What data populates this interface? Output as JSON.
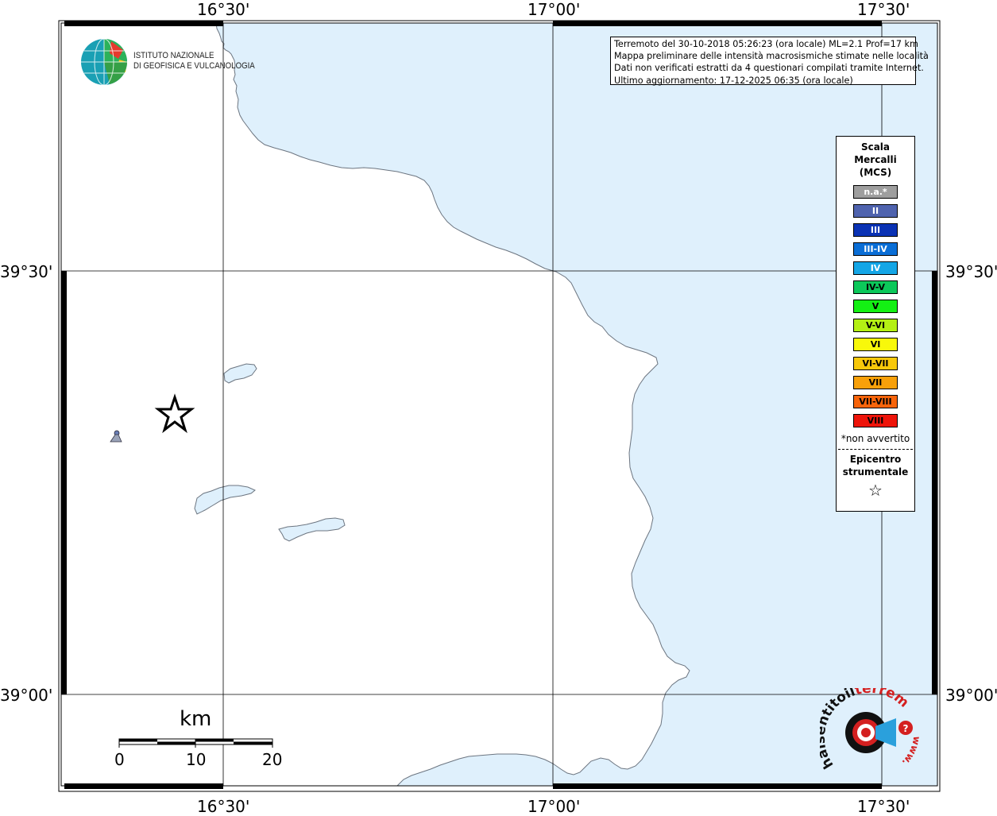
{
  "coords": {
    "top": [
      "16°30'",
      "17°00'",
      "17°30'"
    ],
    "bottom": [
      "16°30'",
      "17°00'",
      "17°30'"
    ],
    "left": [
      "39°30'",
      "39°00'"
    ],
    "right": [
      "39°30'",
      "39°00'"
    ]
  },
  "info": {
    "line1": "Terremoto del 30-10-2018 05:26:23 (ora locale) ML=2.1 Prof=17 km",
    "line2": "Mappa preliminare delle intensità macrosismiche stimate nelle località",
    "line3": "Dati non verificati estratti da 4 questionari compilati tramite Internet.",
    "line4": "Ultimo aggiornamento: 17-12-2025 06:35 (ora locale)"
  },
  "logo": {
    "line1": "ISTITUTO NAZIONALE",
    "line2": "DI GEOFISICA E VULCANOLOGIA"
  },
  "legend": {
    "title1": "Scala",
    "title2": "Mercalli",
    "title3": "(MCS)",
    "items": [
      {
        "label": "n.a.*",
        "color": "#9e9e9e",
        "text": "#ffffff"
      },
      {
        "label": "II",
        "color": "#4f63ae",
        "text": "#ffffff"
      },
      {
        "label": "III",
        "color": "#0a32b4",
        "text": "#ffffff"
      },
      {
        "label": "III-IV",
        "color": "#0a6ed6",
        "text": "#ffffff"
      },
      {
        "label": "IV",
        "color": "#14a6e6",
        "text": "#ffffff"
      },
      {
        "label": "IV-V",
        "color": "#0cc85a",
        "text": "#000000"
      },
      {
        "label": "V",
        "color": "#14f014",
        "text": "#000000"
      },
      {
        "label": "V-VI",
        "color": "#b4f014",
        "text": "#000000"
      },
      {
        "label": "VI",
        "color": "#f8f80a",
        "text": "#000000"
      },
      {
        "label": "VI-VII",
        "color": "#f8c80a",
        "text": "#000000"
      },
      {
        "label": "VII",
        "color": "#f8a00a",
        "text": "#000000"
      },
      {
        "label": "VII-VIII",
        "color": "#f8640a",
        "text": "#000000"
      },
      {
        "label": "VIII",
        "color": "#ee140a",
        "text": "#000000"
      }
    ],
    "note": "*non avvertito",
    "epi1": "Epicentro",
    "epi2": "strumentale",
    "star": "☆"
  },
  "scale": {
    "unit": "km",
    "labels": [
      "0",
      "10",
      "20"
    ]
  },
  "hst_logo": {
    "text_black": "haisentitoil",
    "text_red": "terremoto.it",
    "www": "www.",
    "q": "?"
  },
  "colors": {
    "sea": "#dff0fc",
    "coast": "#6c7580",
    "frame": "#000000",
    "grid": "#000000"
  }
}
